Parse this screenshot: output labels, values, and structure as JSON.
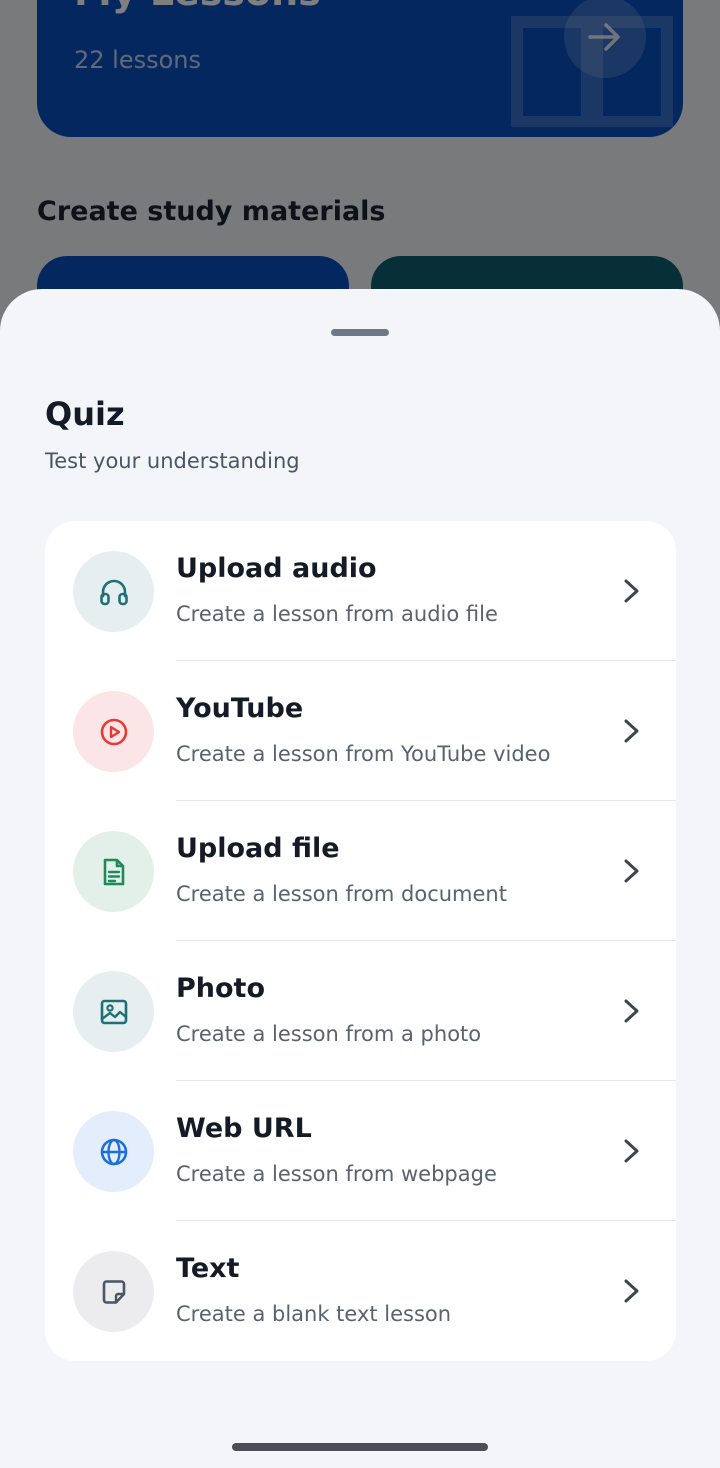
{
  "background": {
    "lessons_card": {
      "title": "My Lessons",
      "count": "22 lessons"
    },
    "section_heading": "Create study materials"
  },
  "sheet": {
    "title": "Quiz",
    "subtitle": "Test your understanding",
    "options": [
      {
        "title": "Upload audio",
        "description": "Create a lesson from audio file",
        "icon": "headphones-icon",
        "icon_color": "#1f6f78",
        "icon_bg": "#e6eef0"
      },
      {
        "title": "YouTube",
        "description": "Create a lesson from YouTube video",
        "icon": "play-circle-icon",
        "icon_color": "#e53935",
        "icon_bg": "#fbe5e6"
      },
      {
        "title": "Upload file",
        "description": "Create a lesson from document",
        "icon": "document-icon",
        "icon_color": "#1e8a5a",
        "icon_bg": "#e3f0ea"
      },
      {
        "title": "Photo",
        "description": "Create a lesson from a photo",
        "icon": "image-icon",
        "icon_color": "#1f6f78",
        "icon_bg": "#e6eef0"
      },
      {
        "title": "Web URL",
        "description": "Create a lesson from webpage",
        "icon": "globe-icon",
        "icon_color": "#1a6ee0",
        "icon_bg": "#e3edfb"
      },
      {
        "title": "Text",
        "description": "Create a blank text lesson",
        "icon": "note-icon",
        "icon_color": "#4b5563",
        "icon_bg": "#ececee"
      }
    ]
  },
  "colors": {
    "primary_blue": "#0a4fc1",
    "teal_card": "#0f5f6e",
    "sheet_bg": "#f3f5f9"
  }
}
